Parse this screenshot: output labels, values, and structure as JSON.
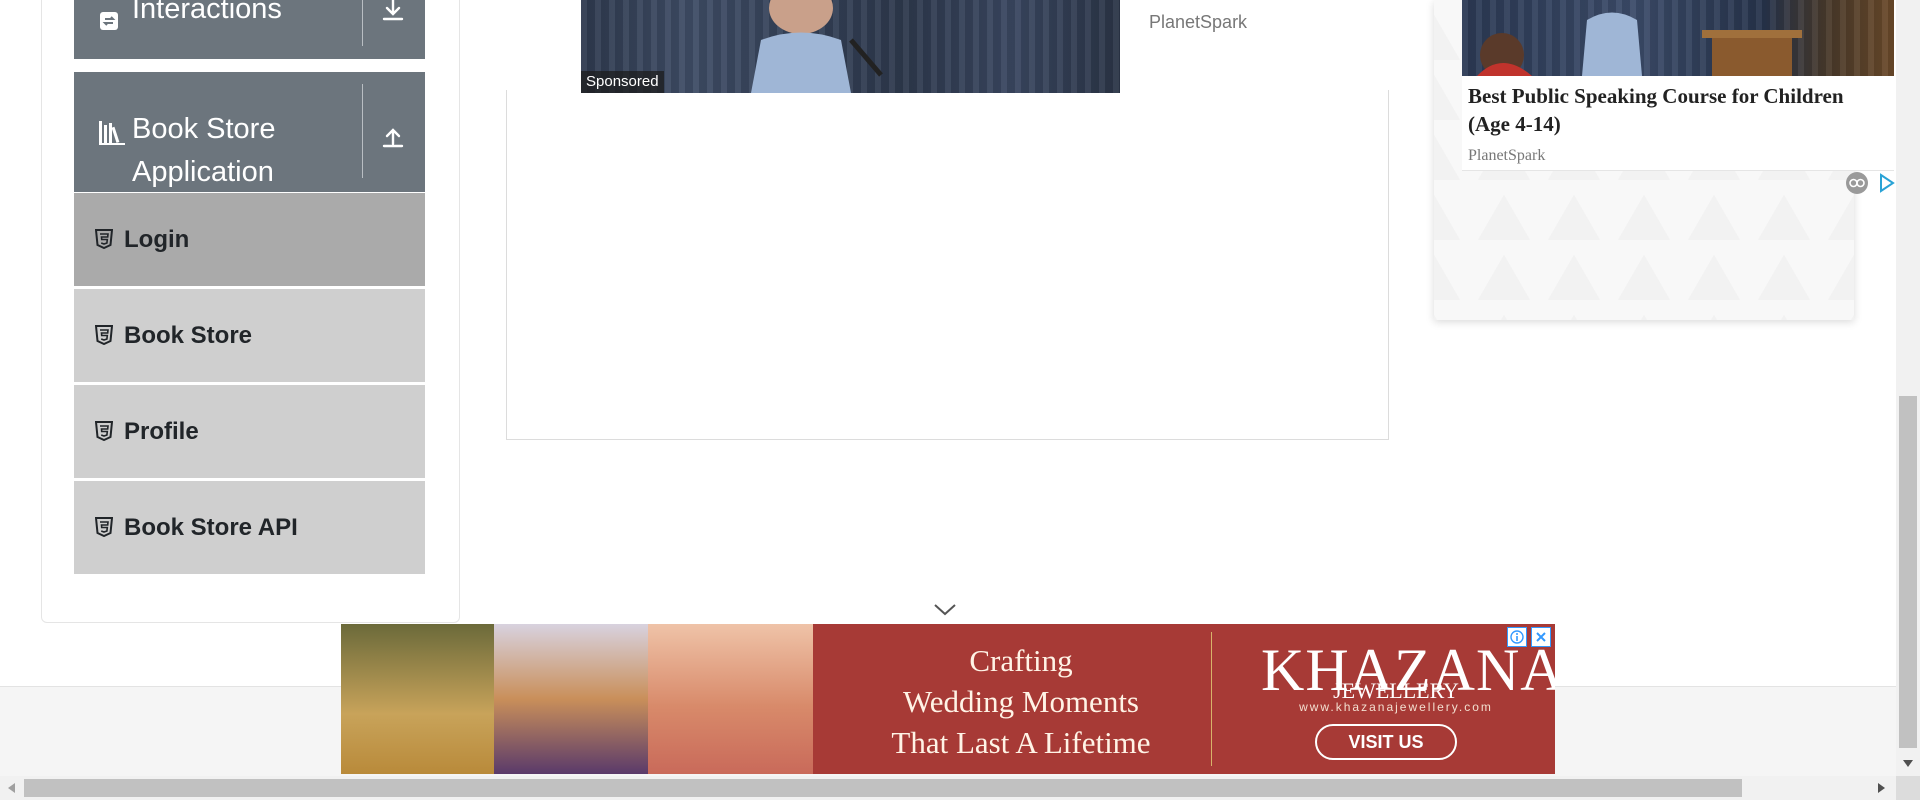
{
  "sidebar": {
    "groups": [
      {
        "label": "Interactions",
        "icon": "interactions-icon",
        "action_icon": "download-icon"
      },
      {
        "label_line1": "Book Store",
        "label_line2": "Application",
        "icon": "books-icon",
        "action_icon": "upload-icon"
      }
    ],
    "items": [
      {
        "label": "Login",
        "icon": "html5-icon",
        "active": true
      },
      {
        "label": "Book Store",
        "icon": "html5-icon",
        "active": false
      },
      {
        "label": "Profile",
        "icon": "html5-icon",
        "active": false
      },
      {
        "label": "Book Store API",
        "icon": "html5-icon",
        "active": false
      }
    ]
  },
  "center_ad": {
    "sponsored_label": "Sponsored",
    "brand": "PlanetSpark"
  },
  "right_ad": {
    "title": "Best Public Speaking Course for Children (Age 4-14)",
    "brand": "PlanetSpark",
    "icons": [
      "adchoices-eye-icon",
      "adchoices-play-icon"
    ]
  },
  "bottom_banner": {
    "tagline_line1": "Crafting",
    "tagline_line2": "Wedding Moments",
    "tagline_line3": "That Last A Lifetime",
    "brand_line1": "KHAZANA",
    "brand_line2": "JEWELLERY",
    "url": "www.khazanajewellery.com",
    "cta": "VISIT US",
    "icons": [
      "info-icon",
      "close-icon"
    ]
  },
  "colors": {
    "sidebar_header_bg": "#6c757d",
    "menu_item_bg": "#cfcfcf",
    "menu_item_active_bg": "#aaaaaa",
    "banner_red": "#a73a36"
  },
  "scrollbars": {
    "vertical_thumb_position": 0.51,
    "horizontal_thumb_position": 0.0
  }
}
